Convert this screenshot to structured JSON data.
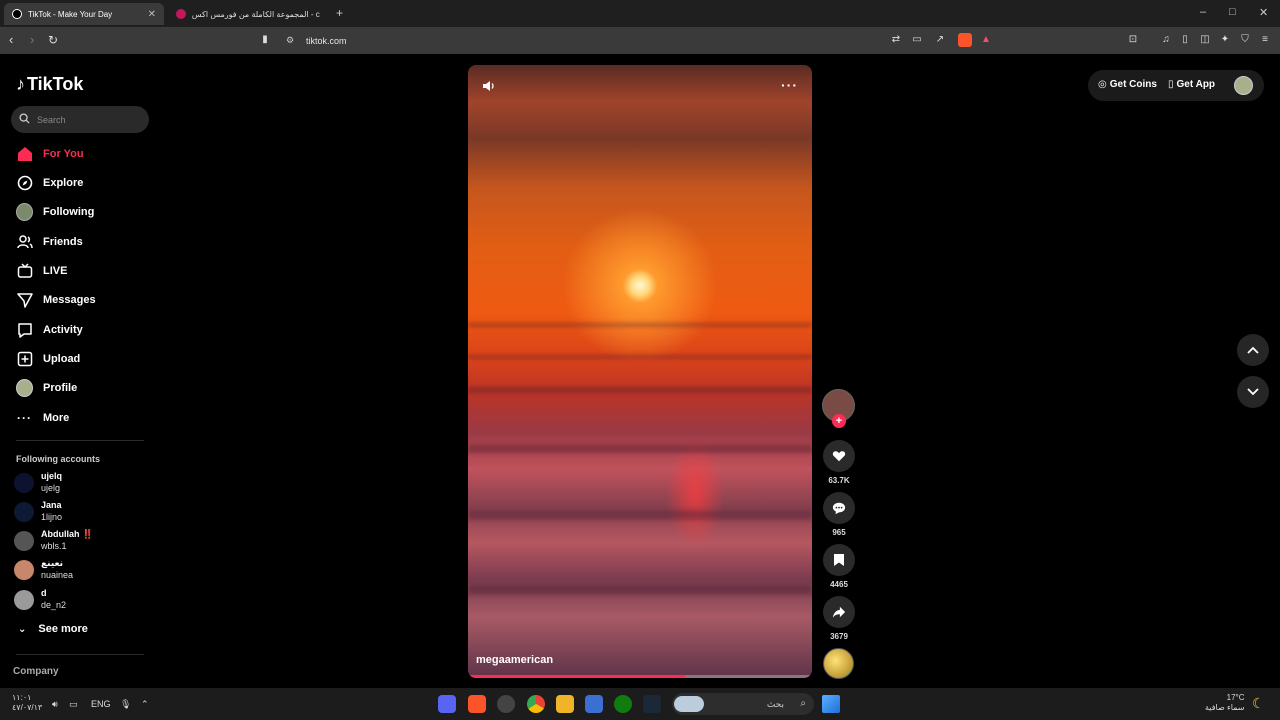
{
  "browser": {
    "tabs": [
      {
        "title": "TikTok - Make Your Day",
        "active": true
      },
      {
        "title": "المجموعة الكاملة من فورمس اكس - cex",
        "active": false
      }
    ],
    "new_tab": "+",
    "url": "tiktok.com",
    "window_controls": {
      "minimize": "–",
      "maximize": "□",
      "close": "✕"
    }
  },
  "sidebar": {
    "logo_text": "TikTok",
    "search_placeholder": "Search",
    "nav": [
      {
        "label": "For You",
        "icon": "home-icon",
        "active": true
      },
      {
        "label": "Explore",
        "icon": "compass-icon"
      },
      {
        "label": "Following",
        "icon": "avatar-icon"
      },
      {
        "label": "Friends",
        "icon": "friends-icon"
      },
      {
        "label": "LIVE",
        "icon": "live-icon"
      },
      {
        "label": "Messages",
        "icon": "messages-icon"
      },
      {
        "label": "Activity",
        "icon": "activity-icon"
      },
      {
        "label": "Upload",
        "icon": "upload-icon"
      },
      {
        "label": "Profile",
        "icon": "profile-icon"
      },
      {
        "label": "More",
        "icon": "more-icon"
      }
    ],
    "following_title": "Following accounts",
    "accounts": [
      {
        "name": "ujelq",
        "handle": "ujelg",
        "color": "#0d1230"
      },
      {
        "name": "Jana",
        "handle": "1lijno",
        "color": "#0c1a33"
      },
      {
        "name": "Abdullah ‼️",
        "handle": "wbls.1",
        "color": "#555555"
      },
      {
        "name": "نعينع",
        "handle": "nuainea",
        "color": "#c8866a"
      },
      {
        "name": "d",
        "handle": "de_n2",
        "color": "#9a9a9a"
      }
    ],
    "see_more": "See more",
    "company": "Company"
  },
  "video": {
    "username": "megaamerican",
    "progress": 0.63
  },
  "actions": {
    "likes": "63.7K",
    "comments": "965",
    "saves": "4465",
    "shares": "3679"
  },
  "top_right": {
    "get_coins": "Get Coins",
    "get_app": "Get App"
  },
  "taskbar": {
    "time": "١١:٠١",
    "date": "٤٧/٠٧/١٣",
    "language": "ENG",
    "search_placeholder": "بحث",
    "weather_temp": "17°C",
    "weather_text": "سماء صافية"
  },
  "colors": {
    "accent": "#fe2c55",
    "bg": "#000000",
    "panel": "#2a2a2a"
  }
}
